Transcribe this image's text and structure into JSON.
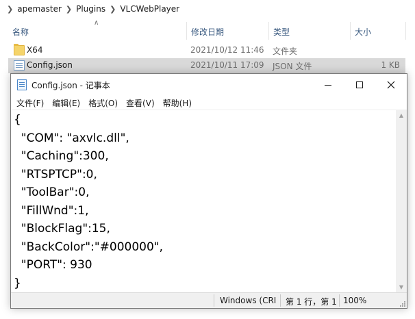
{
  "explorer": {
    "breadcrumb": [
      "apemaster",
      "Plugins",
      "VLCWebPlayer"
    ],
    "columns": {
      "name": "名称",
      "date": "修改日期",
      "type": "类型",
      "size": "大小"
    },
    "files": [
      {
        "name": "X64",
        "date": "2021/10/12 11:46",
        "type": "文件夹",
        "size": "",
        "icon": "folder-icon"
      },
      {
        "name": "Config.json",
        "date": "2021/10/11 17:09",
        "type": "JSON 文件",
        "size": "1 KB",
        "icon": "json-file-icon"
      }
    ]
  },
  "notepad": {
    "title": "Config.json - 记事本",
    "menu": [
      "文件(F)",
      "编辑(E)",
      "格式(O)",
      "查看(V)",
      "帮助(H)"
    ],
    "content_lines": [
      "{",
      "  \"COM\": \"axvlc.dll\",",
      "  \"Caching\":300,",
      "  \"RTSPTCP\":0,",
      "  \"ToolBar\":0,",
      "  \"FillWnd\":1,",
      "  \"BlockFlag\":15,",
      "  \"BackColor\":\"#000000\",",
      "  \"PORT\": 930",
      "}"
    ],
    "status": {
      "line_ending": "Windows (CRI",
      "position": "第 1 行，第 1",
      "zoom": "100%"
    }
  }
}
